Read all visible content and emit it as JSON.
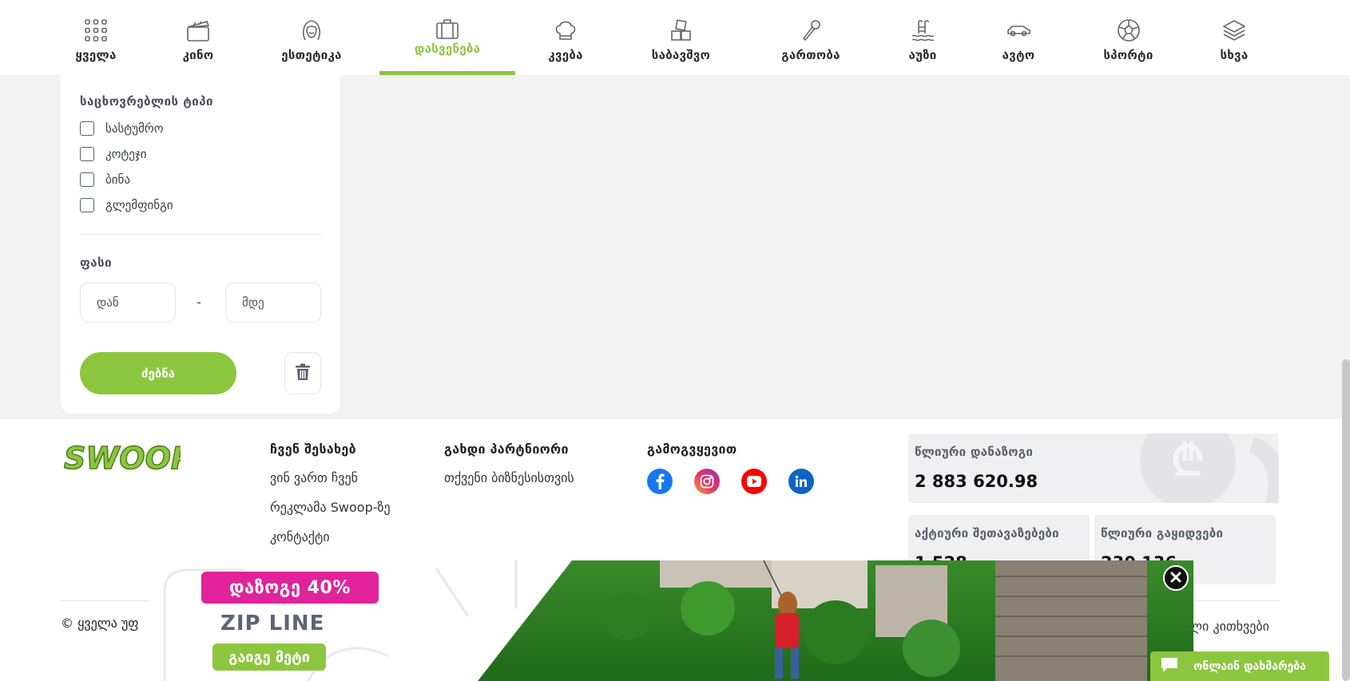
{
  "nav": {
    "items": [
      {
        "label": "ყველა",
        "icon": "grid-icon"
      },
      {
        "label": "კინო",
        "icon": "clapperboard-icon"
      },
      {
        "label": "ესთეტიკა",
        "icon": "face-icon"
      },
      {
        "label": "დასვენება",
        "icon": "suitcase-icon",
        "active": true
      },
      {
        "label": "კვება",
        "icon": "chef-hat-icon"
      },
      {
        "label": "საბავშვო",
        "icon": "toy-blocks-icon"
      },
      {
        "label": "გართობა",
        "icon": "microphone-icon"
      },
      {
        "label": "აუზი",
        "icon": "pool-icon"
      },
      {
        "label": "ავტო",
        "icon": "car-icon"
      },
      {
        "label": "სპორტი",
        "icon": "soccer-ball-icon"
      },
      {
        "label": "სხვა",
        "icon": "layers-icon"
      }
    ]
  },
  "filters": {
    "housing_title": "საცხოვრებლის ტიპი",
    "housing_options": [
      "სასტუმრო",
      "კოტეჯი",
      "ბინა",
      "გლემფინგი"
    ],
    "price_title": "ფასი",
    "price_from_placeholder": "დან",
    "price_to_placeholder": "მდე",
    "price_separator": "-",
    "search_label": "ძებნა"
  },
  "footer": {
    "logo_text": "SWOOP",
    "about_title": "ჩვენ შესახებ",
    "about_links": [
      "ვინ ვართ ჩვენ",
      "რეკლამა Swoop-ზე",
      "კონტაქტი"
    ],
    "partner_title": "გახდი პარტნიორი",
    "partner_links": [
      "თქვენი ბიზნესისთვის"
    ],
    "follow_title": "გამოგვყევით",
    "social": [
      "facebook-icon",
      "instagram-icon",
      "youtube-icon",
      "linkedin-icon"
    ],
    "stats": {
      "savings_title": "წლიური დანაზოგი",
      "savings_value": "2 883 620.98",
      "offers_title": "აქტიური შეთავაზებები",
      "offers_value": "1 528",
      "sales_title": "წლიური გაყიდვები",
      "sales_value": "230 136"
    },
    "copyright": "© ყველა უფ",
    "faq": "ლი კითხვები"
  },
  "banner": {
    "discount": "დაზოგე 40%",
    "product": "ZIP LINE",
    "cta": "გაიგე მეტი"
  },
  "chat": {
    "label": "ონლაინ დახმარება"
  },
  "colors": {
    "accent": "#8cc63e",
    "pink": "#e0239a"
  }
}
